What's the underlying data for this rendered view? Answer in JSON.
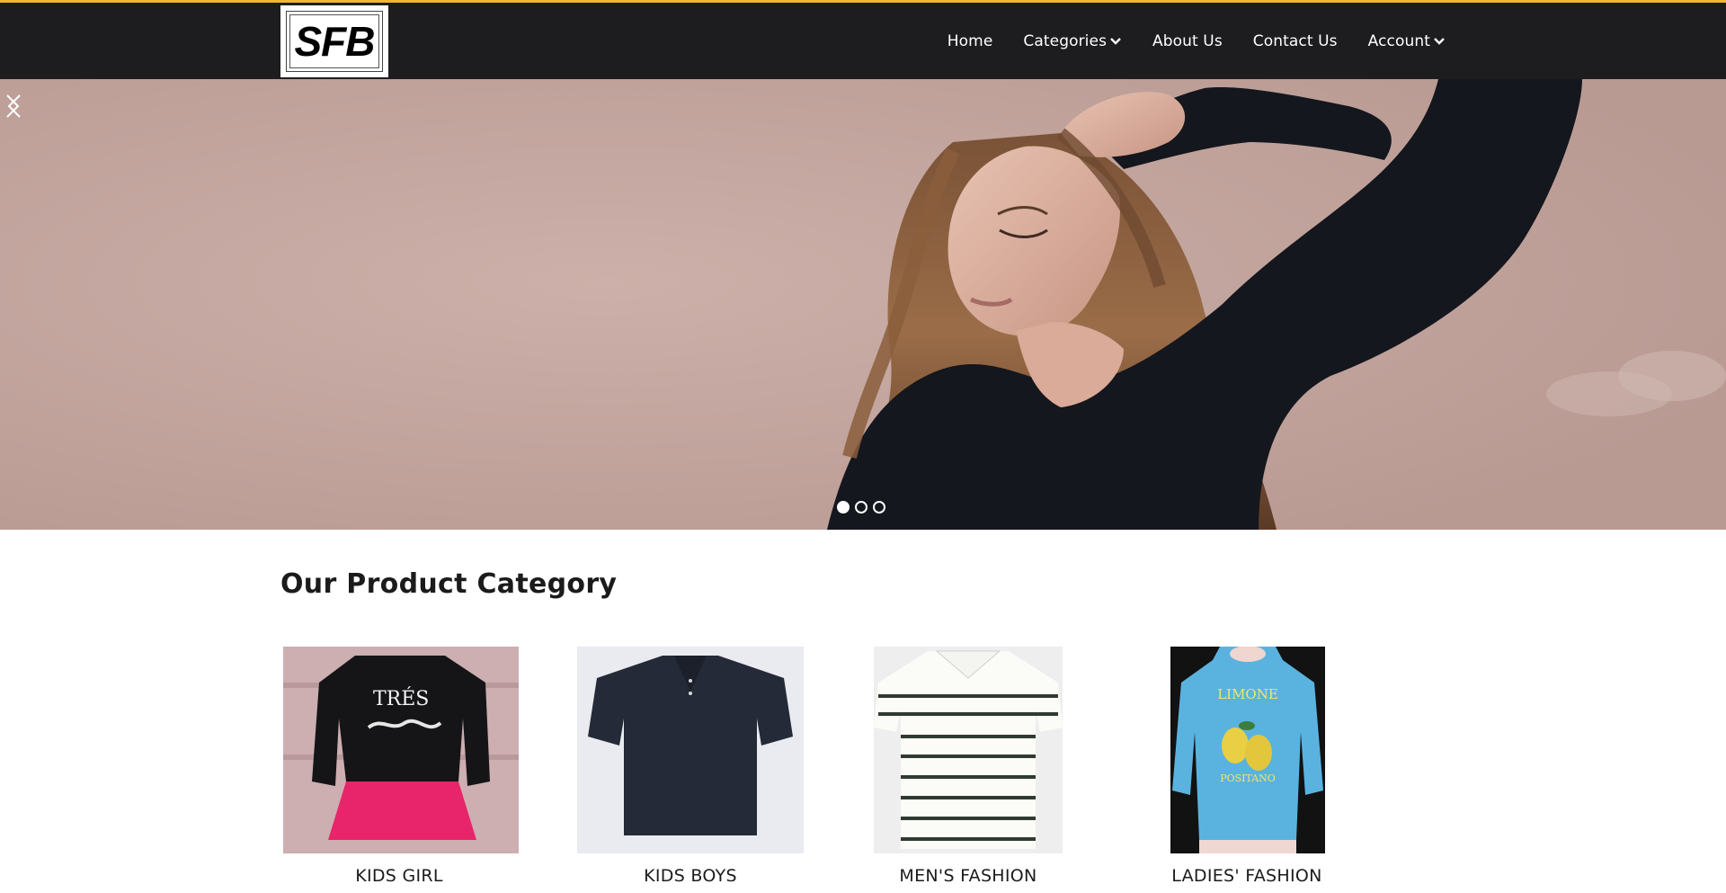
{
  "header": {
    "logo_text": "SFB",
    "nav": [
      {
        "label": "Home",
        "has_dropdown": false
      },
      {
        "label": "Categories",
        "has_dropdown": true
      },
      {
        "label": "About Us",
        "has_dropdown": false
      },
      {
        "label": "Contact Us",
        "has_dropdown": false
      },
      {
        "label": "Account",
        "has_dropdown": true
      }
    ]
  },
  "carousel": {
    "slide_count": 3,
    "active_slide": 1
  },
  "section": {
    "title": "Our Product Category"
  },
  "categories": [
    {
      "label": "KIDS GIRL"
    },
    {
      "label": "KIDS BOYS"
    },
    {
      "label": "MEN'S FASHION"
    },
    {
      "label": "LADIES' FASHION"
    }
  ],
  "colors": {
    "accent": "#f3b533",
    "header_bg": "#1d1d20"
  }
}
